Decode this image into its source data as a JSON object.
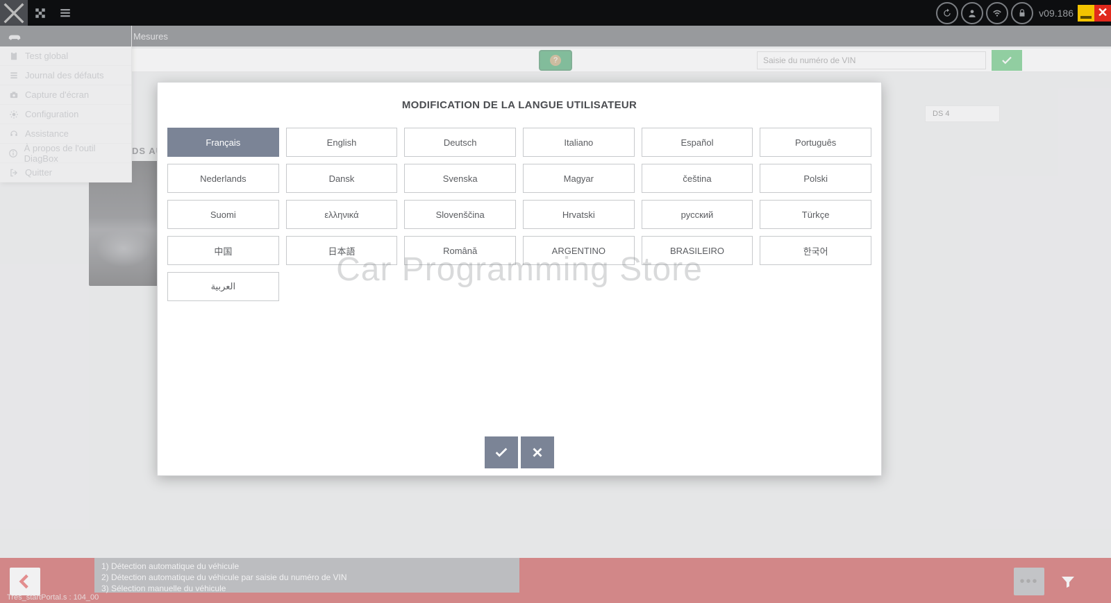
{
  "topbar": {
    "version": "v09.186"
  },
  "secondbar": {
    "breadcrumb": "Mesures"
  },
  "sidebar": {
    "items": [
      {
        "label": "Test global"
      },
      {
        "label": "Journal des défauts"
      },
      {
        "label": "Capture d'écran"
      },
      {
        "label": "Configuration"
      },
      {
        "label": "Assistance"
      },
      {
        "label": "À propos de l'outil DiagBox"
      },
      {
        "label": "Quitter"
      }
    ]
  },
  "vinbar": {
    "placeholder": "Saisie du numéro de VIN"
  },
  "brand": "DS AU",
  "modeltab": "DS 4",
  "modal": {
    "title": "MODIFICATION DE LA LANGUE UTILISATEUR",
    "watermark": "Car Programming Store",
    "languages": [
      "Français",
      "English",
      "Deutsch",
      "Italiano",
      "Español",
      "Português",
      "Nederlands",
      "Dansk",
      "Svenska",
      "Magyar",
      "čeština",
      "Polski",
      "Suomi",
      "ελληνικά",
      "Slovenščina",
      "Hrvatski",
      "русский",
      "Türkçe",
      "中国",
      "日本語",
      "Română",
      "ARGENTINO",
      "BRASILEIRO",
      "한국어",
      "العربية"
    ],
    "selected_index": 0
  },
  "bottom": {
    "msg1": "1) Détection automatique du véhicule",
    "msg2": "2) Détection automatique du véhicule par saisie du numéro de VIN",
    "msg3": "3) Sélection manuelle du véhicule",
    "status": "Tres_startPortal.s : 104_00"
  }
}
